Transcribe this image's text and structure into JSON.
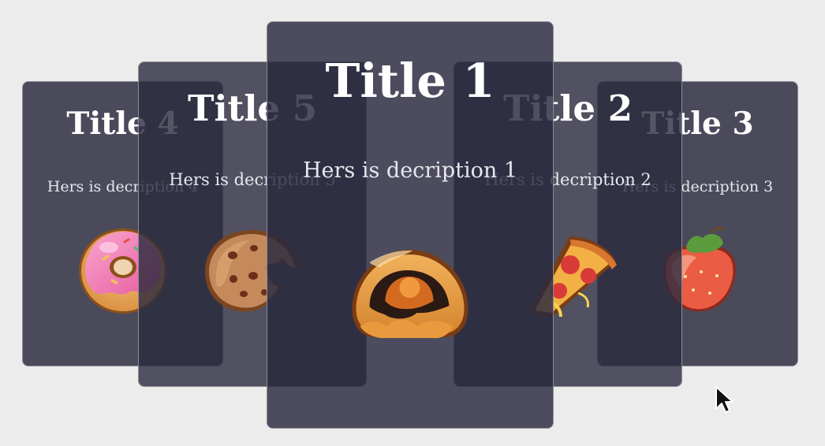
{
  "carousel": {
    "cards": [
      {
        "id": "card-1",
        "title": "Title 1",
        "description": "Hers is decription 1",
        "image": "bun-icon"
      },
      {
        "id": "card-2",
        "title": "Title 2",
        "description": "Hers is decription 2",
        "image": "pizza-slice-icon"
      },
      {
        "id": "card-3",
        "title": "Title 3",
        "description": "Hers is decription 3",
        "image": "strawberry-icon"
      },
      {
        "id": "card-4",
        "title": "Title 4",
        "description": "Hers is decription 4",
        "image": "donut-icon"
      },
      {
        "id": "card-5",
        "title": "Title 5",
        "description": "Hers is decription 5",
        "image": "cookie-icon"
      }
    ]
  },
  "colors": {
    "background": "#ececec",
    "card_background": "#2b2b42",
    "text": "#ffffff"
  }
}
